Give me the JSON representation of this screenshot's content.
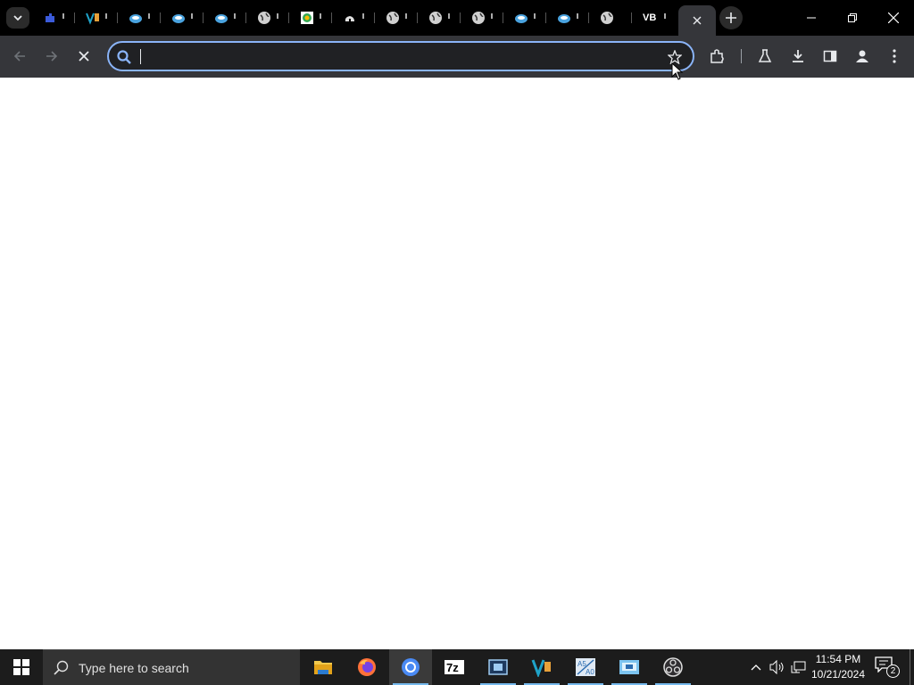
{
  "browser": {
    "tabs": [
      {
        "icon": "puzzle-favicon-icon",
        "color": "#3b5bdb"
      },
      {
        "icon": "vb-favicon-icon",
        "color": "#1fa3c9"
      },
      {
        "icon": "blue-bird-favicon-icon",
        "color": "#4aa3df"
      },
      {
        "icon": "blue-bird-favicon-icon",
        "color": "#4aa3df"
      },
      {
        "icon": "blue-bird-favicon-icon",
        "color": "#4aa3df"
      },
      {
        "icon": "globe-favicon-icon",
        "color": "#d0d0d0"
      },
      {
        "icon": "chrome-web-favicon-icon",
        "color": "#34a853"
      },
      {
        "icon": "cloud-favicon-icon",
        "color": "#e0e0e0"
      },
      {
        "icon": "globe-favicon-icon",
        "color": "#d0d0d0"
      },
      {
        "icon": "globe-favicon-icon",
        "color": "#d0d0d0"
      },
      {
        "icon": "globe-favicon-icon",
        "color": "#d0d0d0"
      },
      {
        "icon": "blue-bird-favicon-icon",
        "color": "#4aa3df"
      },
      {
        "icon": "blue-bird-favicon-icon",
        "color": "#4aa3df"
      },
      {
        "icon": "globe-favicon-icon",
        "color": "#d0d0d0"
      },
      {
        "icon": "vb-text-favicon-icon",
        "color": "#ffffff",
        "label": "VB"
      }
    ],
    "omnibox": {
      "value": "",
      "placeholder": ""
    },
    "accent": "#8ab4f8"
  },
  "taskbar": {
    "search_placeholder": "Type here to search",
    "apps": [
      "file-explorer",
      "firefox",
      "chrome",
      "7zip",
      "video-editor",
      "vb-app",
      "calculator-app",
      "control-panel",
      "obs-studio"
    ],
    "clock": {
      "time": "11:54 PM",
      "date": "10/21/2024"
    },
    "notification_count": "2"
  }
}
